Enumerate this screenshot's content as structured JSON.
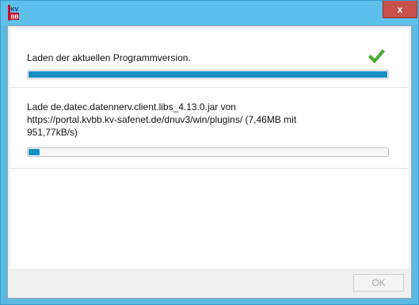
{
  "window": {
    "icon": "kvbb-logo-icon",
    "icon_text_top": "KV",
    "icon_text_bottom": "BB",
    "close_label": "x"
  },
  "step1": {
    "label": "Laden der aktuellen Programmversion.",
    "status_icon": "checkmark-icon",
    "progress": 1.0
  },
  "step2": {
    "label": "Lade de.datec.datennerv.client.libs_4.13.0.jar von https://portal.kvbb.kv-safenet.de/dnuv3/win/plugins/ (7,46MB mit 951,77kB/s)",
    "progress": 0.03
  },
  "buttons": {
    "ok_label": "OK"
  },
  "colors": {
    "titlebar": "#5cc0ea",
    "progress_fill": "#1a8fc4",
    "check": "#4aa832",
    "close": "#c7504a"
  }
}
